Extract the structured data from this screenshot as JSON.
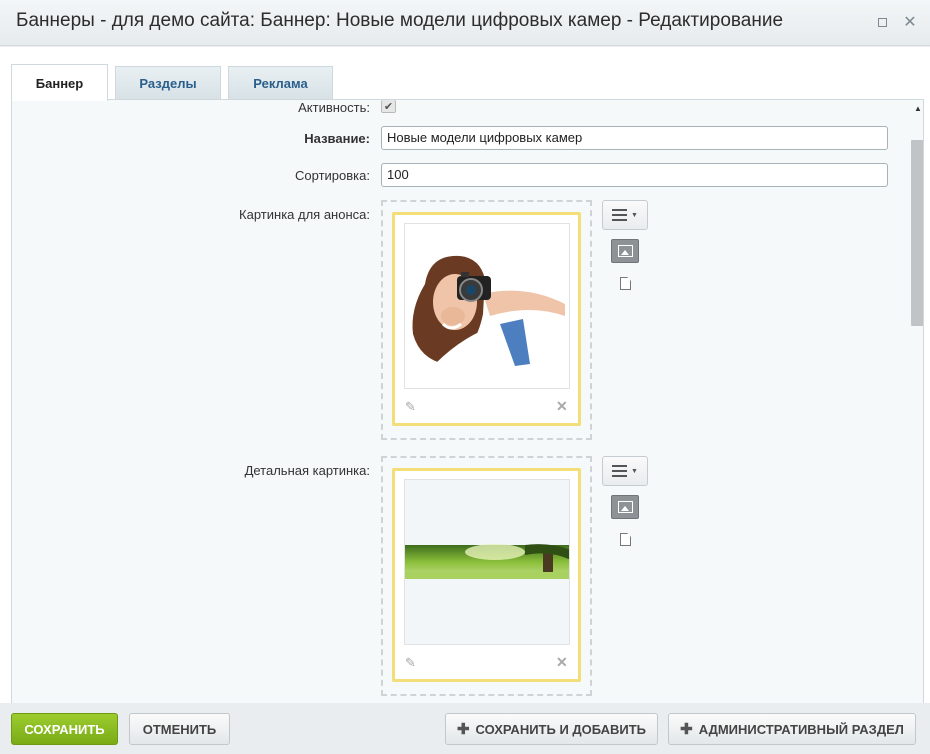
{
  "window": {
    "title": "Баннеры - для демо сайта: Баннер: Новые модели цифровых камер - Редактирование",
    "maximize_icon": "maximize-icon",
    "close_icon": "close-icon"
  },
  "tabs": [
    {
      "label": "Баннер",
      "active": true
    },
    {
      "label": "Разделы",
      "active": false
    },
    {
      "label": "Реклама",
      "active": false
    }
  ],
  "form": {
    "active": {
      "label": "Активность:",
      "checked": true
    },
    "name": {
      "label": "Название:",
      "value": "Новые модели цифровых камер"
    },
    "sort": {
      "label": "Сортировка:",
      "value": "100"
    },
    "preview_image": {
      "label": "Картинка для анонса:"
    },
    "detail_image": {
      "label": "Детальная картинка:"
    }
  },
  "buttons": {
    "save": "Сохранить",
    "cancel": "Отменить",
    "save_add": "Сохранить и добавить",
    "admin_section": "Административный раздел"
  },
  "colors": {
    "save_button": "#8ebf22",
    "tab_inactive_text": "#2a5f8b",
    "image_frame_border": "#f3de7a"
  }
}
